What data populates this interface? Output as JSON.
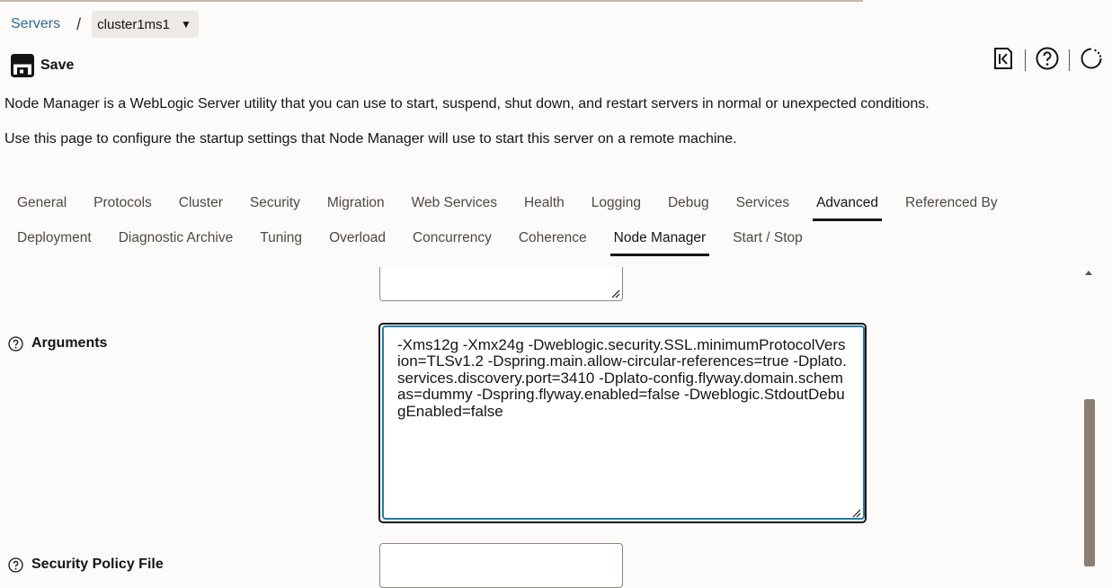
{
  "breadcrumb": {
    "link": "Servers",
    "separator": "/",
    "current": "cluster1ms1"
  },
  "toolbar": {
    "save_label": "Save",
    "icons": [
      "back-to-start-icon",
      "help-icon",
      "refresh-icon"
    ]
  },
  "description": {
    "line1": "Node Manager is a WebLogic Server utility that you can use to start, suspend, shut down, and restart servers in normal or unexpected conditions.",
    "line2": "Use this page to configure the startup settings that Node Manager will use to start this server on a remote machine."
  },
  "tabs_row1": [
    "General",
    "Protocols",
    "Cluster",
    "Security",
    "Migration",
    "Web Services",
    "Health",
    "Logging",
    "Debug",
    "Services",
    "Advanced",
    "Referenced By"
  ],
  "tabs_row2": [
    "Deployment",
    "Diagnostic Archive",
    "Tuning",
    "Overload",
    "Concurrency",
    "Coherence",
    "Node Manager",
    "Start / Stop"
  ],
  "active_tabs": [
    "Advanced",
    "Node Manager"
  ],
  "fields": {
    "arguments_label": "Arguments",
    "arguments_value": "-Xms12g -Xmx24g -Dweblogic.security.SSL.minimumProtocolVersion=TLSv1.2 -Dspring.main.allow-circular-references=true -Dplato.services.discovery.port=3410 -Dplato-config.flyway.domain.schemas=dummy -Dspring.flyway.enabled=false -Dweblogic.StdoutDebugEnabled=false",
    "security_policy_label": "Security Policy File"
  },
  "colors": {
    "link": "#2d6a9c",
    "focus": "#227ca6",
    "scroll_thumb": "#8b7f75"
  }
}
